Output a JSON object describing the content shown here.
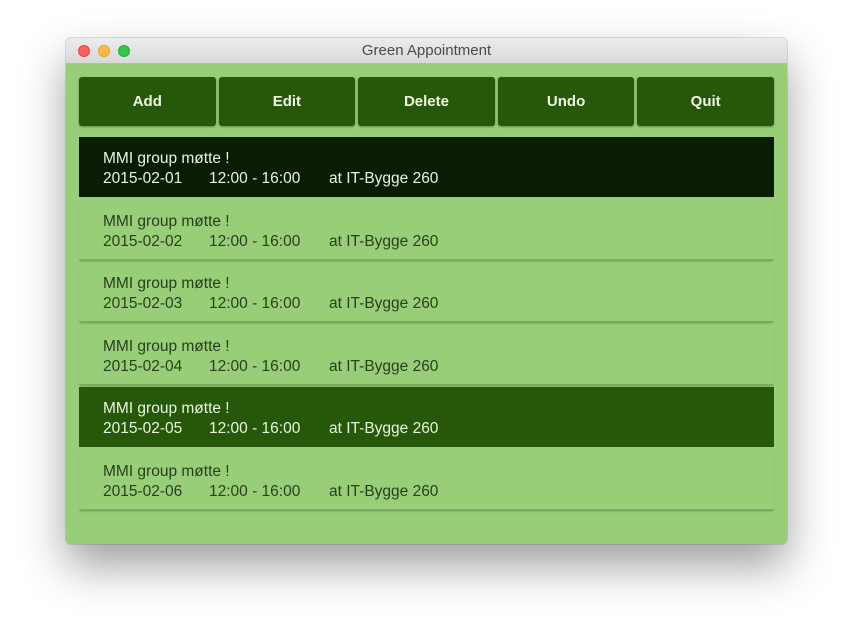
{
  "window": {
    "title": "Green Appointment"
  },
  "toolbar": {
    "add_label": "Add",
    "edit_label": "Edit",
    "delete_label": "Delete",
    "undo_label": "Undo",
    "quit_label": "Quit"
  },
  "colors": {
    "background": "#98ce78",
    "button": "#27580a",
    "focused_row": "#0b1c04",
    "selected_row": "#27580a"
  },
  "appointments": [
    {
      "title": "MMI group møtte !",
      "date": "2015-02-01",
      "time": "12:00 - 16:00",
      "location": "at IT-Bygge 260",
      "state": "focused"
    },
    {
      "title": "MMI group møtte !",
      "date": "2015-02-02",
      "time": "12:00 - 16:00",
      "location": "at IT-Bygge 260",
      "state": "normal"
    },
    {
      "title": "MMI group møtte !",
      "date": "2015-02-03",
      "time": "12:00 - 16:00",
      "location": "at IT-Bygge 260",
      "state": "normal"
    },
    {
      "title": "MMI group møtte !",
      "date": "2015-02-04",
      "time": "12:00 - 16:00",
      "location": "at IT-Bygge 260",
      "state": "normal"
    },
    {
      "title": "MMI group møtte !",
      "date": "2015-02-05",
      "time": "12:00 - 16:00",
      "location": "at IT-Bygge 260",
      "state": "selected"
    },
    {
      "title": "MMI group møtte !",
      "date": "2015-02-06",
      "time": "12:00 - 16:00",
      "location": "at IT-Bygge 260",
      "state": "normal"
    }
  ]
}
